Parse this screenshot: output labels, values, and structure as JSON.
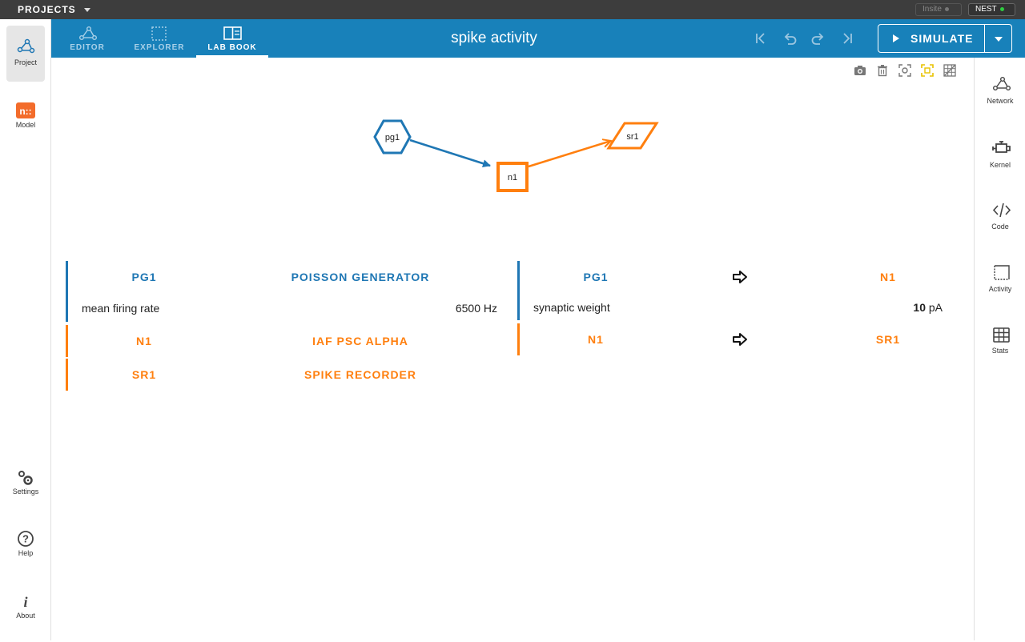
{
  "topbar": {
    "projects_label": "PROJECTS",
    "backends": [
      {
        "label": "Insite",
        "status": "inactive"
      },
      {
        "label": "NEST",
        "status": "active",
        "status_color": "#2ecc40"
      }
    ]
  },
  "leftnav": {
    "top_items": [
      {
        "label": "Project",
        "icon": "network-icon",
        "active": true
      },
      {
        "label": "Model",
        "icon": "nest-model-icon",
        "active": false
      }
    ],
    "bottom_items": [
      {
        "label": "Settings",
        "icon": "gears-icon"
      },
      {
        "label": "Help",
        "icon": "help-circle-icon"
      },
      {
        "label": "About",
        "icon": "info-icon"
      }
    ]
  },
  "header": {
    "tabs": [
      {
        "label": "EDITOR",
        "icon": "network-icon",
        "active": false
      },
      {
        "label": "EXPLORER",
        "icon": "dashed-square-icon",
        "active": false
      },
      {
        "label": "LAB BOOK",
        "icon": "book-icon",
        "active": true
      }
    ],
    "title": "spike activity",
    "history": [
      "first-icon",
      "undo-icon",
      "redo-icon",
      "last-icon"
    ],
    "simulate_label": "SIMULATE",
    "colors": {
      "header_bg": "#1881ba"
    }
  },
  "rightnav": {
    "items": [
      {
        "label": "Network",
        "icon": "network-icon"
      },
      {
        "label": "Kernel",
        "icon": "engine-icon"
      },
      {
        "label": "Code",
        "icon": "code-icon"
      },
      {
        "label": "Activity",
        "icon": "activity-icon"
      },
      {
        "label": "Stats",
        "icon": "table-icon"
      }
    ]
  },
  "graph_toolbar": [
    "camera-icon",
    "trash-icon",
    "focus-icon",
    "fit-icon",
    "grid-icon"
  ],
  "graph": {
    "nodes": [
      {
        "label": "pg1",
        "shape": "hexagon",
        "color": "#1f77b4"
      },
      {
        "label": "n1",
        "shape": "square",
        "color": "#ff7f0e"
      },
      {
        "label": "sr1",
        "shape": "parallelogram",
        "color": "#ff7f0e"
      }
    ]
  },
  "nodes_table": [
    {
      "name": "PG1",
      "model": "POISSON GENERATOR",
      "color": "blue",
      "param": {
        "label": "mean firing rate",
        "value": "6500 Hz"
      }
    },
    {
      "name": "N1",
      "model": "IAF PSC ALPHA",
      "color": "orange"
    },
    {
      "name": "SR1",
      "model": "SPIKE RECORDER",
      "color": "orange"
    }
  ],
  "connections_table": [
    {
      "source": "PG1",
      "target": "N1",
      "color": "blue",
      "param": {
        "label": "synaptic weight",
        "value": "10",
        "unit": "pA"
      }
    },
    {
      "source": "N1",
      "target": "SR1",
      "color": "orange"
    }
  ]
}
